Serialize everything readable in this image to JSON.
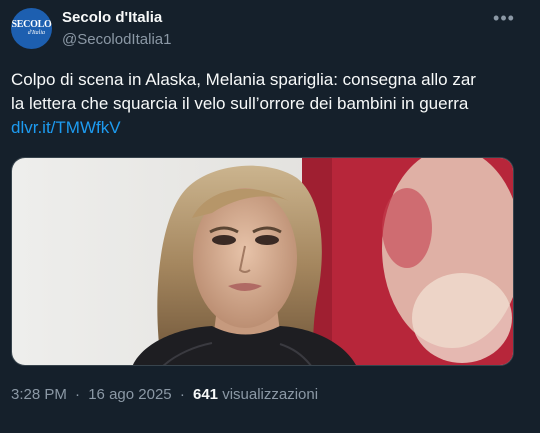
{
  "author": {
    "display_name": "Secolo d'Italia",
    "handle": "@SecolodItalia1",
    "avatar_logo_main": "SECOLO",
    "avatar_logo_sub": "d'Italia"
  },
  "tweet": {
    "text_line_1": "Colpo di scena in Alaska, Melania spariglia: consegna allo zar",
    "text_line_2": "la lettera che squarcia il velo sull’orrore dei bambini in guerra",
    "link": "dlvr.it/TMWfkV"
  },
  "meta": {
    "time": "3:28 PM",
    "separator": "·",
    "date": "16 ago 2025",
    "views_count": "641",
    "views_label": "visualizzazioni"
  },
  "icons": {
    "more": "more-horizontal-icon"
  },
  "colors": {
    "background": "#15202b",
    "primary_text": "#f7f9f9",
    "secondary_text": "#8b98a5",
    "link": "#1d9bf0",
    "avatar": "#1d5fb0"
  }
}
